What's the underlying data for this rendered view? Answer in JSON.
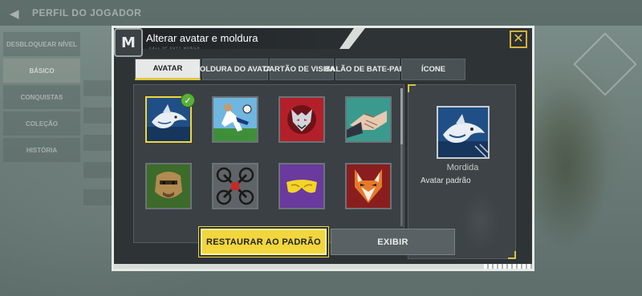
{
  "background": {
    "header_title": "PERFIL DO JOGADOR",
    "menu_items": [
      "DESBLOQUEAR NÍVEL",
      "BÁSICO",
      "CONQUISTAS",
      "COLEÇÃO",
      "HISTÓRIA"
    ],
    "active_menu_index": 1
  },
  "dialog": {
    "title": "Alterar avatar e moldura",
    "subtitle": "CALL OF DUTY MOBILE",
    "logo_letter": "M",
    "close_icon": "close-icon",
    "accent_color": "#f1d63e"
  },
  "tabs": [
    {
      "label": "AVATAR",
      "active": true
    },
    {
      "label": "MOLDURA DO AVATAR",
      "active": false
    },
    {
      "label": "CARTÃO DE VISITAS",
      "active": false
    },
    {
      "label": "BALÃO DE BATE-PAPO",
      "active": false
    },
    {
      "label": "ÍCONE",
      "active": false
    }
  ],
  "avatars": [
    {
      "name": "shark-avatar",
      "selected": true
    },
    {
      "name": "soccer-player-avatar",
      "selected": false
    },
    {
      "name": "demon-wolf-avatar",
      "selected": false
    },
    {
      "name": "handshake-avatar",
      "selected": false
    },
    {
      "name": "gorilla-mask-avatar",
      "selected": false
    },
    {
      "name": "drone-avatar",
      "selected": false
    },
    {
      "name": "purple-goggles-avatar",
      "selected": false
    },
    {
      "name": "fox-mask-avatar",
      "selected": false
    }
  ],
  "preview": {
    "name": "Mordida",
    "description": "Avatar padrão"
  },
  "buttons": {
    "restore_label": "RESTAURAR AO PADRÃO",
    "show_label": "EXIBIR"
  }
}
